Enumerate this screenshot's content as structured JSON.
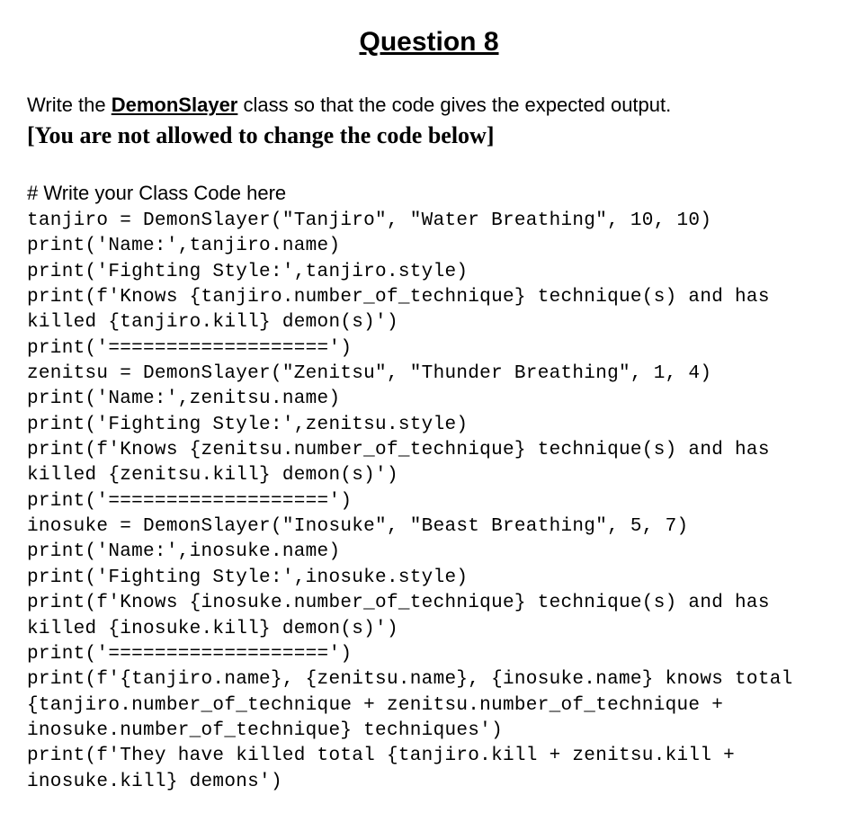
{
  "title": "Question 8",
  "instruction": {
    "prefix": "Write the ",
    "class_name": "DemonSlayer",
    "suffix": " class so that the code gives the expected output."
  },
  "restriction": "[You are not allowed to change the code below]",
  "hash_comment": "# Write your Class Code here",
  "code": "tanjiro = DemonSlayer(\"Tanjiro\", \"Water Breathing\", 10, 10)\nprint('Name:',tanjiro.name)\nprint('Fighting Style:',tanjiro.style)\nprint(f'Knows {tanjiro.number_of_technique} technique(s) and has killed {tanjiro.kill} demon(s)')\nprint('===================')\nzenitsu = DemonSlayer(\"Zenitsu\", \"Thunder Breathing\", 1, 4)\nprint('Name:',zenitsu.name)\nprint('Fighting Style:',zenitsu.style)\nprint(f'Knows {zenitsu.number_of_technique} technique(s) and has killed {zenitsu.kill} demon(s)')\nprint('===================')\ninosuke = DemonSlayer(\"Inosuke\", \"Beast Breathing\", 5, 7)\nprint('Name:',inosuke.name)\nprint('Fighting Style:',inosuke.style)\nprint(f'Knows {inosuke.number_of_technique} technique(s) and has killed {inosuke.kill} demon(s)')\nprint('===================')\nprint(f'{tanjiro.name}, {zenitsu.name}, {inosuke.name} knows total {tanjiro.number_of_technique + zenitsu.number_of_technique + inosuke.number_of_technique} techniques')\nprint(f'They have killed total {tanjiro.kill + zenitsu.kill + inosuke.kill} demons')"
}
